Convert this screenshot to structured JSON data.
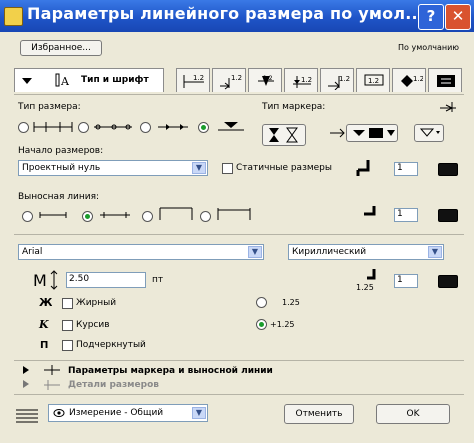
{
  "window": {
    "title": "Параметры линейного размера по умол...",
    "help_glyph": "?",
    "close_glyph": "✕"
  },
  "top": {
    "favorites_label": "Избранное...",
    "default_label": "По умолчанию"
  },
  "tabs": {
    "active_label": "Тип и шрифт",
    "others": [
      "1.2",
      "1.2",
      "1.2",
      "1.2",
      "1.2",
      "1.2",
      "1.2"
    ]
  },
  "dimension_type": {
    "label": "Тип размера:",
    "selected_index": 3
  },
  "marker_type": {
    "label": "Тип маркера:"
  },
  "dimension_start": {
    "label": "Начало размеров:",
    "value": "Проектный нуль",
    "static_label": "Статичные размеры",
    "pen_value": "1"
  },
  "extension_line": {
    "label": "Выносная линия:",
    "selected_index": 1,
    "pen_value": "1"
  },
  "font": {
    "family": "Arial",
    "charset": "Кириллический",
    "size_value": "2.50",
    "size_unit": "пт",
    "pen_label": "1.25",
    "pen_value": "1",
    "bold_label": "Жирный",
    "italic_label": "Курсив",
    "underline_label": "Подчеркнутый",
    "option_a": "1.25",
    "option_b": "+1.25",
    "selected_option": "b"
  },
  "sections": {
    "marker_section": "Параметры маркера и выносной линии",
    "details_section": "Детали размеров"
  },
  "footer": {
    "layer_value": "Измерение - Общий",
    "cancel_label": "Отменить",
    "ok_label": "OK"
  },
  "colors": {
    "titlebar": "#1f55c8",
    "selected_radio": "#1a9c2c",
    "close_button": "#d9532f"
  }
}
